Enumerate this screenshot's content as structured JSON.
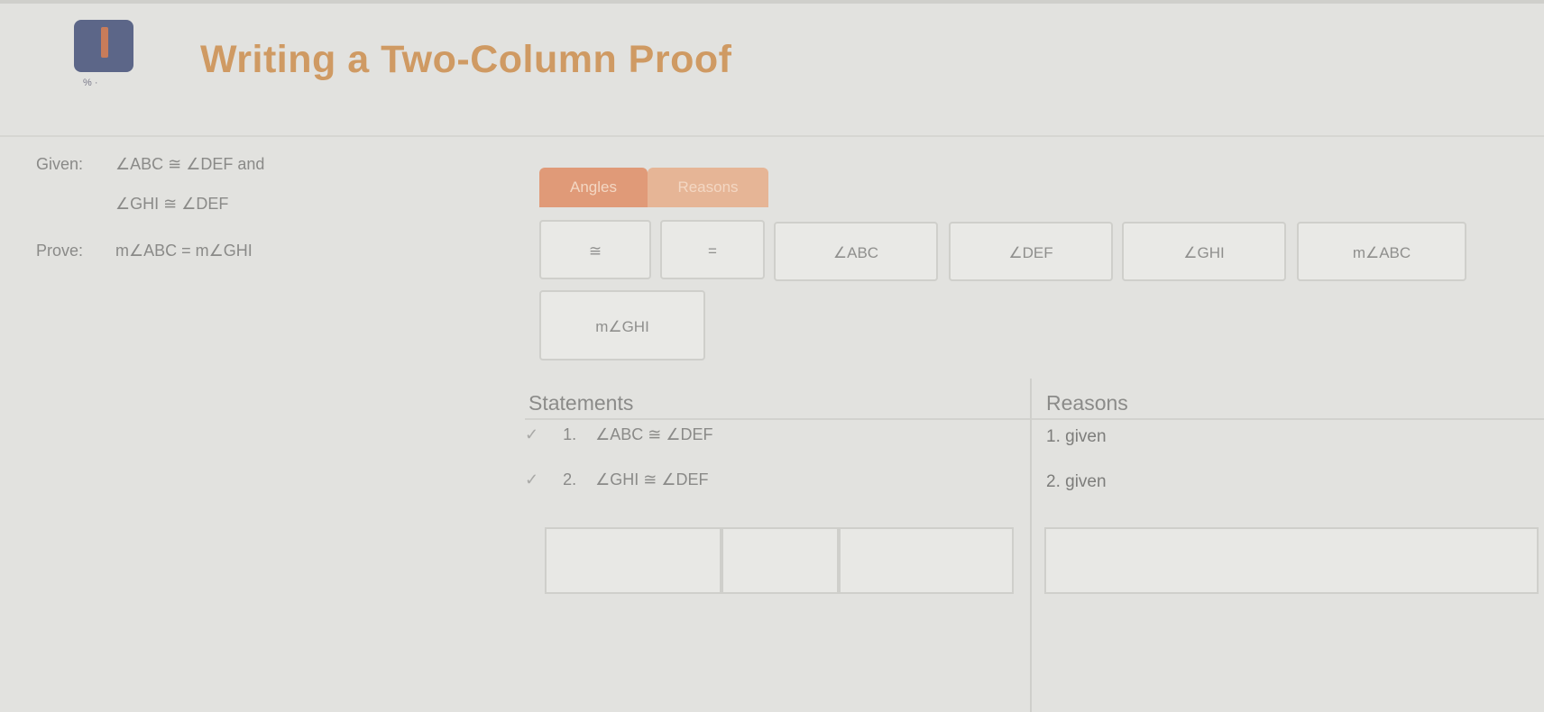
{
  "header": {
    "title": "Writing a Two-Column Proof",
    "badge_caption": "% ·"
  },
  "problem": {
    "given_label": "Given:",
    "given_line1": "∠ABC ≅ ∠DEF and",
    "given_line2": "∠GHI ≅ ∠DEF",
    "prove_label": "Prove:",
    "prove_expr": "m∠ABC = m∠GHI"
  },
  "tabs": [
    "Angles",
    "Reasons"
  ],
  "chips": [
    "≅",
    "=",
    "∠ABC",
    "∠DEF",
    "∠GHI",
    "m∠ABC",
    "m∠GHI"
  ],
  "table": {
    "headers": {
      "statements": "Statements",
      "reasons": "Reasons"
    },
    "rows": [
      {
        "num": "1.",
        "statement": "∠ABC ≅ ∠DEF",
        "reason": "1. given"
      },
      {
        "num": "2.",
        "statement": "∠GHI ≅ ∠DEF",
        "reason": "2. given"
      }
    ]
  },
  "colors": {
    "title": "#cf9a63",
    "tab_active": "#e09a78",
    "tab_inactive": "#e6b596",
    "badge": "#5c6688"
  }
}
